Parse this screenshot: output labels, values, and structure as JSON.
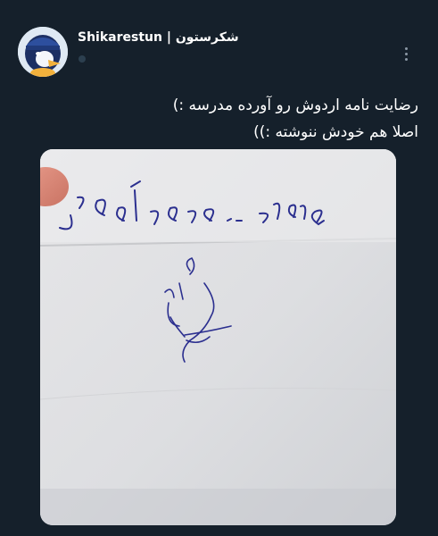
{
  "post": {
    "author_name": "Shikarestun | شکرستون",
    "author_handle": "",
    "text_lines": [
      "رضایت نامه اردوش رو آورده مدرسه :)",
      "اصلا هم خودش ننوشته :))"
    ]
  },
  "media": {
    "kind": "photo of handwritten note",
    "handwriting_line": "می تونی بری بابی اردو",
    "signature_text": "مادرم"
  },
  "colors": {
    "background": "#15202b",
    "text": "#ffffff",
    "muted": "#8b98a5"
  },
  "icons": {
    "avatar": "penguin-avatar",
    "more": "more-vertical-icon"
  }
}
